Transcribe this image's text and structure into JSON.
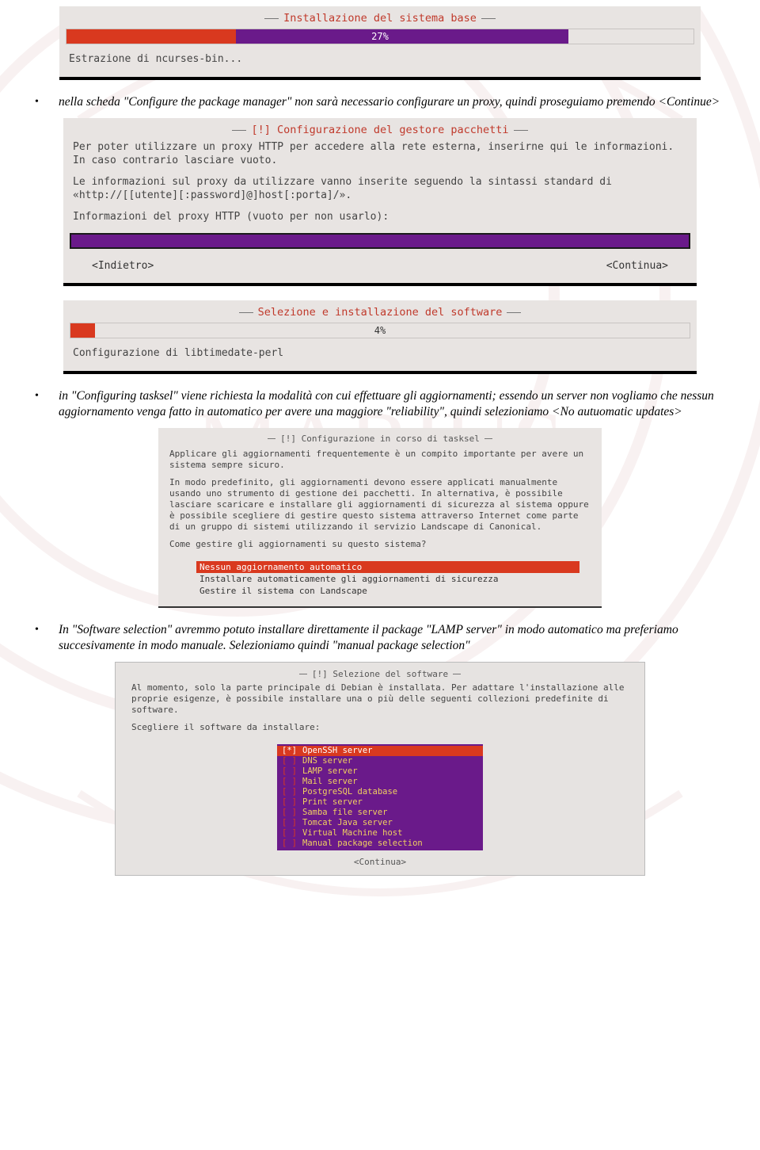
{
  "panel1": {
    "title": "Installazione del sistema base",
    "progress_pct": "27%",
    "progress_value": 27,
    "status": "Estrazione di ncurses-bin..."
  },
  "bullet1": "nella scheda \"Configure the package manager\" non sarà necessario configurare un proxy, quindi proseguiamo premendo <Continue>",
  "panel2": {
    "title": "[!] Configurazione del gestore pacchetti",
    "body1": "Per poter utilizzare un proxy HTTP per accedere alla rete esterna, inserirne qui le informazioni. In caso contrario lasciare vuoto.",
    "body2": "Le informazioni sul proxy da utilizzare vanno inserite seguendo la sintassi standard di «http://[[utente][:password]@]host[:porta]/».",
    "body3": "Informazioni del proxy HTTP (vuoto per non usarlo):",
    "back": "<Indietro>",
    "continue": "<Continua>"
  },
  "panel3": {
    "title": "Selezione e installazione del software",
    "progress_pct": "4%",
    "progress_value": 4,
    "status": "Configurazione di libtimedate-perl"
  },
  "bullet2": "in \"Configuring tasksel\" viene richiesta la modalità con cui effettuare gli aggiornamenti; essendo un server non vogliamo che nessun aggiornamento venga fatto in automatico per avere una maggiore \"reliability\", quindi selezioniamo <No autuomatic updates>",
  "panel4": {
    "title": "[!] Configurazione in corso di tasksel",
    "body1": "Applicare gli aggiornamenti frequentemente è un compito importante per avere un sistema sempre sicuro.",
    "body2": "In modo predefinito, gli aggiornamenti devono essere applicati manualmente usando uno strumento di gestione dei pacchetti. In alternativa, è possibile lasciare scaricare e installare gli aggiornamenti di sicurezza al sistema oppure è possibile scegliere di gestire questo sistema attraverso Internet come parte di un gruppo di sistemi utilizzando il servizio Landscape di Canonical.",
    "body3": "Come gestire gli aggiornamenti su questo sistema?",
    "opt1": "Nessun aggiornamento automatico",
    "opt2": "Installare automaticamente gli aggiornamenti di sicurezza",
    "opt3": "Gestire il sistema con Landscape"
  },
  "bullet3": "In \"Software selection\" avremmo potuto installare direttamente il package \"LAMP server\" in modo automatico ma preferiamo succesivamente in modo manuale. Selezioniamo quindi \"manual package selection\"",
  "panel5": {
    "title": "[!] Selezione del software",
    "body1": "Al momento, solo la parte principale di Debian è installata. Per adattare l'installazione alle proprie esigenze, è possibile installare una o più delle seguenti collezioni predefinite di software.",
    "body2": "Scegliere il software da installare:",
    "options": [
      {
        "mark": "[*]",
        "label": "OpenSSH server",
        "hl": true
      },
      {
        "mark": "[ ]",
        "label": "DNS server",
        "hl": false
      },
      {
        "mark": "[ ]",
        "label": "LAMP server",
        "hl": false
      },
      {
        "mark": "[ ]",
        "label": "Mail server",
        "hl": false
      },
      {
        "mark": "[ ]",
        "label": "PostgreSQL database",
        "hl": false
      },
      {
        "mark": "[ ]",
        "label": "Print server",
        "hl": false
      },
      {
        "mark": "[ ]",
        "label": "Samba file server",
        "hl": false
      },
      {
        "mark": "[ ]",
        "label": "Tomcat Java server",
        "hl": false
      },
      {
        "mark": "[ ]",
        "label": "Virtual Machine host",
        "hl": false
      },
      {
        "mark": "[ ]",
        "label": "Manual package selection",
        "hl": false
      }
    ],
    "continue": "<Continua>"
  }
}
